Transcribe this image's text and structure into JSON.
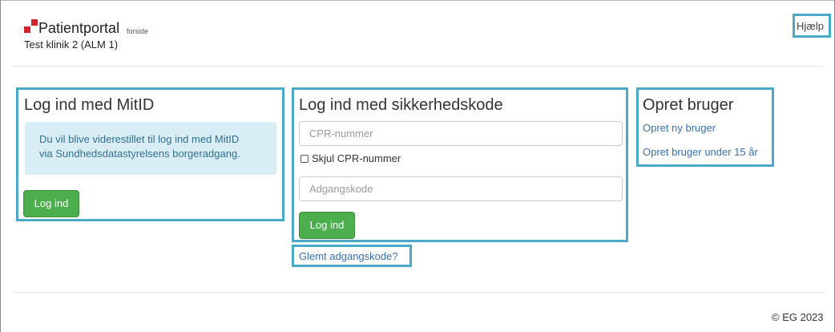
{
  "header": {
    "brand": "Patientportal",
    "brand_sub": "forside",
    "clinic": "Test klinik 2 (ALM 1)",
    "help_label": "Hjælp"
  },
  "mitid": {
    "title": "Log ind med MitID",
    "info_line1": "Du vil blive viderestillet til log ind med MitID",
    "info_line2": "via Sundhedsdatastyrelsens borgeradgang.",
    "login_label": "Log ind"
  },
  "code_login": {
    "title": "Log ind med sikkerhedskode",
    "cpr_placeholder": "CPR-nummer",
    "hide_cpr_label": "Skjul CPR-nummer",
    "password_placeholder": "Adgangskode",
    "login_label": "Log ind",
    "forgot_label": "Glemt adgangskode?"
  },
  "create_user": {
    "title": "Opret bruger",
    "new_user_link": "Opret ny bruger",
    "under15_link": "Opret bruger under 15 år"
  },
  "footer": {
    "copyright": "© EG 2023"
  },
  "colors": {
    "highlight": "#49a9c6",
    "brand_red": "#d2232a",
    "button_green": "#4cae4c",
    "info_bg": "#d9edf7",
    "link_blue": "#3a6fad"
  }
}
